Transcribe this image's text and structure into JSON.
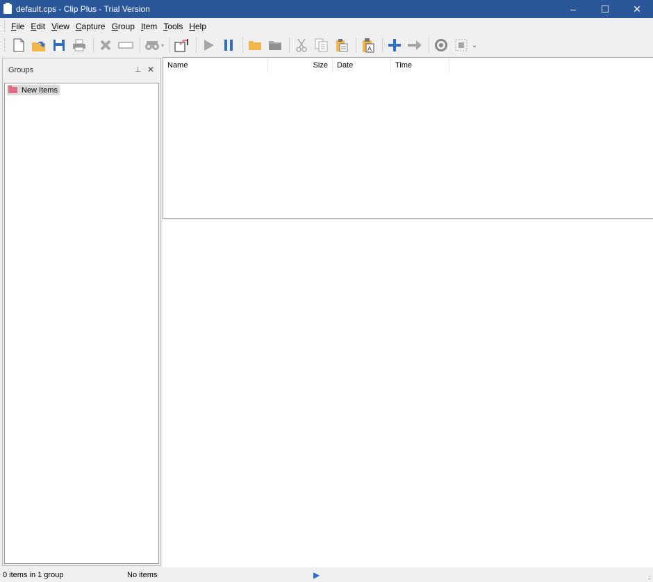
{
  "window": {
    "title": "default.cps - Clip Plus - Trial Version",
    "minimize": "–",
    "maximize": "☐",
    "close": "✕"
  },
  "menu": [
    {
      "label": "File",
      "key": "F",
      "rest": "ile"
    },
    {
      "label": "Edit",
      "key": "E",
      "rest": "dit"
    },
    {
      "label": "View",
      "key": "V",
      "rest": "iew"
    },
    {
      "label": "Capture",
      "key": "C",
      "rest": "apture"
    },
    {
      "label": "Group",
      "key": "G",
      "rest": "roup"
    },
    {
      "label": "Item",
      "key": "I",
      "rest": "tem"
    },
    {
      "label": "Tools",
      "key": "T",
      "rest": "ools"
    },
    {
      "label": "Help",
      "key": "H",
      "rest": "elp"
    }
  ],
  "toolbar": {
    "icons": [
      "new-icon",
      "open-icon",
      "save-icon",
      "print-icon",
      "delete-icon",
      "rename-icon",
      "find-icon",
      "find-dropdown-icon",
      "new-window-icon",
      "play-icon",
      "pause-icon",
      "folder-open-icon",
      "folder-icon",
      "cut-icon",
      "copy-icon",
      "paste-icon",
      "paste-text-icon",
      "add-icon",
      "forward-icon",
      "capture-icon",
      "select-region-icon",
      "more-dropdown-icon"
    ],
    "colors": {
      "blue": "#2e6fc4",
      "orange": "#f3b64a",
      "gray": "#a6a6a6"
    }
  },
  "groups_panel": {
    "title": "Groups",
    "pin": "⊥",
    "close": "✕",
    "items": [
      {
        "label": "New Items",
        "color": "#e06b84"
      }
    ]
  },
  "list": {
    "columns": [
      {
        "label": "Name"
      },
      {
        "label": "Size"
      },
      {
        "label": "Date"
      },
      {
        "label": "Time"
      }
    ]
  },
  "status": {
    "left": "0 items in 1 group",
    "middle": "No items",
    "play": "▶"
  }
}
